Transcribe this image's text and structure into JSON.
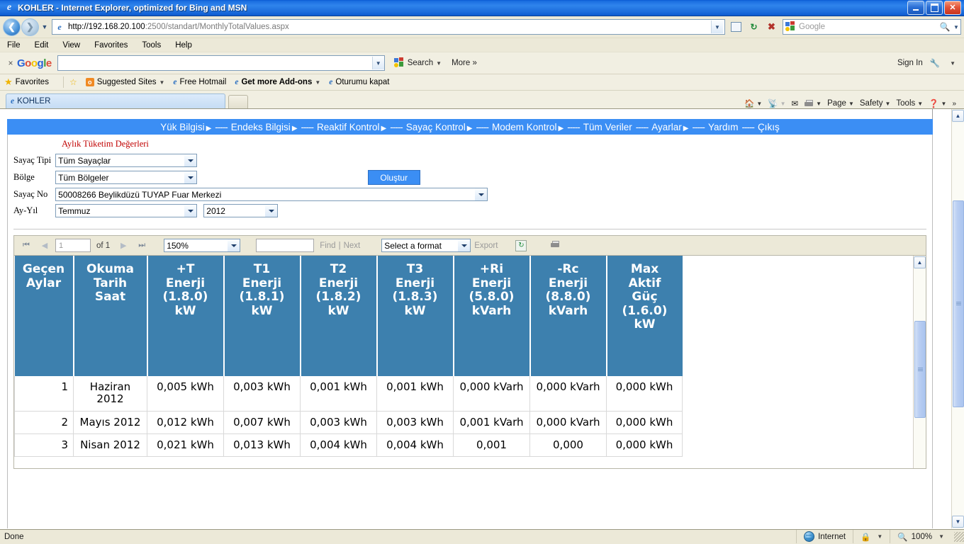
{
  "window": {
    "title": "KOHLER - Internet Explorer, optimized for Bing and MSN",
    "minimize": "_",
    "maximize": "❐",
    "close": "✕"
  },
  "address_bar": {
    "url_protocol_host": "http://192.168.20.100",
    "url_rest": ":2500/standart/MonthlyTotalValues.aspx",
    "search_placeholder": "Google",
    "back_icon": "back-arrow-icon",
    "forward_icon": "forward-arrow-icon",
    "history_icon": "chevron-down-icon",
    "compat_icon": "compatibility-view-icon",
    "go_icon": "refresh-icon",
    "stop_icon": "stop-icon",
    "search_icon": "magnifier-icon"
  },
  "menu_bar": {
    "items": [
      "File",
      "Edit",
      "View",
      "Favorites",
      "Tools",
      "Help"
    ]
  },
  "google_toolbar": {
    "close_label": "×",
    "logo": [
      {
        "t": "G",
        "c": "b"
      },
      {
        "t": "o",
        "c": "r"
      },
      {
        "t": "o",
        "c": "y"
      },
      {
        "t": "g",
        "c": "b"
      },
      {
        "t": "l",
        "c": "g"
      },
      {
        "t": "e",
        "c": "r"
      }
    ],
    "query": "",
    "search_label": "Search",
    "more_label": "More",
    "more_chevron": "»",
    "sign_in": "Sign In",
    "wrench_icon": "wrench-icon"
  },
  "favorites_bar": {
    "favorites_label": "Favorites",
    "items": [
      {
        "label": "Suggested Sites",
        "has_caret": true,
        "icon": "suggested-sites-icon"
      },
      {
        "label": "Free Hotmail",
        "has_caret": false,
        "icon": "ie-page-icon"
      },
      {
        "label": "Get more Add-ons",
        "has_caret": true,
        "icon": "ie-page-icon",
        "bold": true
      },
      {
        "label": "Oturumu kapat",
        "has_caret": false,
        "icon": "ie-page-icon"
      }
    ]
  },
  "tabs": {
    "active_tab": "KOHLER",
    "new_tab_label": ""
  },
  "command_bar": {
    "items": [
      {
        "name": "home-icon",
        "label": ""
      },
      {
        "name": "feeds-icon",
        "label": ""
      },
      {
        "name": "read-mail-icon",
        "label": ""
      },
      {
        "name": "print-icon",
        "label": ""
      },
      {
        "name": "page-menu",
        "label": "Page"
      },
      {
        "name": "safety-menu",
        "label": "Safety"
      },
      {
        "name": "tools-menu",
        "label": "Tools"
      },
      {
        "name": "help-menu",
        "label": ""
      }
    ]
  },
  "site_nav": {
    "items": [
      {
        "label": "Yük Bilgisi",
        "arrow": true
      },
      {
        "label": "Endeks Bilgisi",
        "arrow": true
      },
      {
        "label": "Reaktif Kontrol",
        "arrow": true
      },
      {
        "label": "Sayaç Kontrol",
        "arrow": true
      },
      {
        "label": "Modem Kontrol",
        "arrow": true
      },
      {
        "label": "Tüm Veriler",
        "arrow": false
      },
      {
        "label": "Ayarlar",
        "arrow": true
      },
      {
        "label": "Yardım",
        "arrow": false
      },
      {
        "label": "Çıkış",
        "arrow": false
      }
    ],
    "separator": "-----"
  },
  "form": {
    "heading": "Aylık Tüketim Değerleri",
    "fields": [
      {
        "label": "Sayaç Tipi",
        "value": "Tüm Sayaçlar"
      },
      {
        "label": "Bölge",
        "value": "Tüm Bölgeler"
      },
      {
        "label": "Sayaç No",
        "value": "50008266 Beylikdüzü TUYAP Fuar Merkezi"
      },
      {
        "label": "Ay-Yıl",
        "value": "Temmuz",
        "value2": "2012"
      }
    ],
    "submit_label": "Oluştur"
  },
  "report_toolbar": {
    "first_icon": "first-page-icon",
    "prev_icon": "previous-page-icon",
    "page_number": "1",
    "of_label": "of 1",
    "next_icon": "next-page-icon",
    "last_icon": "last-page-icon",
    "zoom": "150%",
    "find_text": "",
    "find_label": "Find",
    "find_separator": "|",
    "next_label": "Next",
    "format_select": "Select a format",
    "export_label": "Export",
    "refresh_icon": "refresh-icon",
    "print_icon": "print-icon"
  },
  "report_table": {
    "columns": [
      "Geçen\nAylar",
      "Okuma\nTarih\nSaat",
      "+T\nEnerji\n(1.8.0)\nkW",
      "T1\nEnerji\n(1.8.1)\nkW",
      "T2\nEnerji\n(1.8.2)\nkW",
      "T3\nEnerji\n(1.8.3)\nkW",
      "+Ri\nEnerji\n(5.8.0)\nkVarh",
      "-Rc\nEnerji\n(8.8.0)\nkVarh",
      "Max\nAktif\nGüç\n(1.6.0)\nkW"
    ],
    "rows": [
      [
        "1",
        "Haziran 2012",
        "0,005 kWh",
        "0,003 kWh",
        "0,001 kWh",
        "0,001 kWh",
        "0,000 kVarh",
        "0,000 kVarh",
        "0,000 kWh"
      ],
      [
        "2",
        "Mayıs 2012",
        "0,012 kWh",
        "0,007 kWh",
        "0,003 kWh",
        "0,003 kWh",
        "0,001 kVarh",
        "0,000 kVarh",
        "0,000 kWh"
      ],
      [
        "3",
        "Nisan 2012",
        "0,021 kWh",
        "0,013 kWh",
        "0,004 kWh",
        "0,004 kWh",
        "0,001",
        "0,000",
        "0,000 kWh"
      ]
    ]
  },
  "status_bar": {
    "message": "Done",
    "zone": "Internet",
    "zone_icon": "globe-icon",
    "protected_icon": "protected-mode-icon",
    "zoom_icon": "magnifier-icon",
    "zoom_level": "100%"
  },
  "colors": {
    "title_blue": "#1b6fe0",
    "nav_blue": "#3b8ef4",
    "table_header": "#3d80ae",
    "heading_red": "#c00000",
    "chrome": "#ece9d8"
  }
}
